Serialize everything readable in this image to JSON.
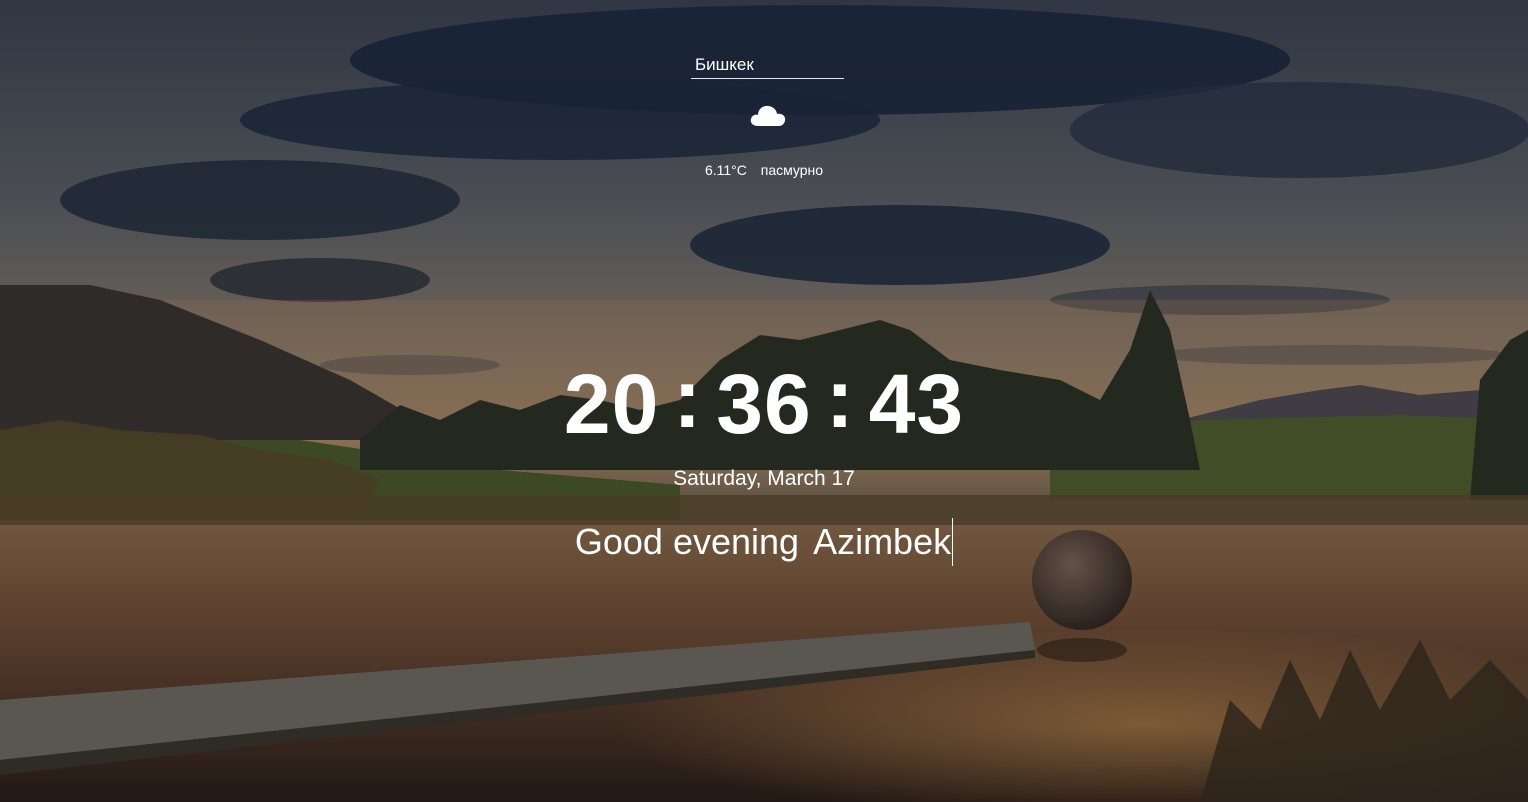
{
  "weather": {
    "city_value": "Бишкек",
    "icon": "cloud-icon",
    "temperature": "6.11°C",
    "description": "пасмурно"
  },
  "clock": {
    "hours": "20",
    "minutes": "36",
    "seconds": "43",
    "separator": ":"
  },
  "date": "Saturday, March 17",
  "greeting": {
    "text": "Good evening",
    "name": "Azimbek"
  },
  "colors": {
    "text": "#ffffff",
    "sky_dark": "#1c2a40",
    "sunset": "#c8884a"
  }
}
